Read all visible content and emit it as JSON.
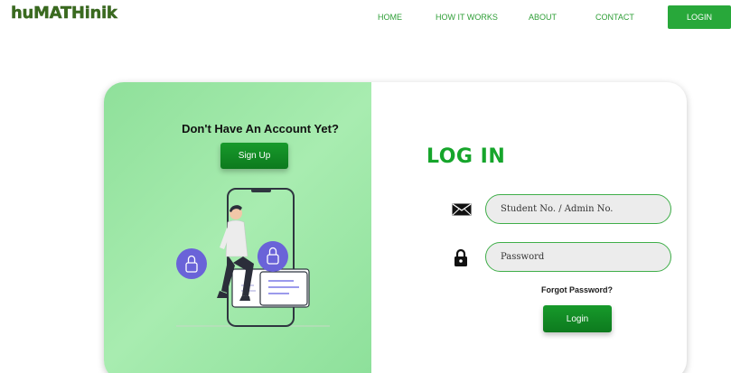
{
  "header": {
    "logo_text": "huMATHinik",
    "nav": [
      {
        "label": "HOME"
      },
      {
        "label": "HOW IT WORKS"
      },
      {
        "label": "ABOUT"
      },
      {
        "label": "CONTACT"
      }
    ],
    "login_label": "LOGIN"
  },
  "left_panel": {
    "title": "Don't Have An Account Yet?",
    "signup_label": "Sign Up"
  },
  "login_form": {
    "title": "LOG IN",
    "student_placeholder": "Student No. / Admin No.",
    "password_placeholder": "Password",
    "forgot_label": "Forgot Password?",
    "submit_label": "Login",
    "icons": [
      "envelope-icon",
      "lock-icon"
    ]
  },
  "colors": {
    "accent": "#28a83a",
    "panel_green": "#9be6a5",
    "title_green": "#16a52b",
    "logo": "#3a6b1f"
  }
}
